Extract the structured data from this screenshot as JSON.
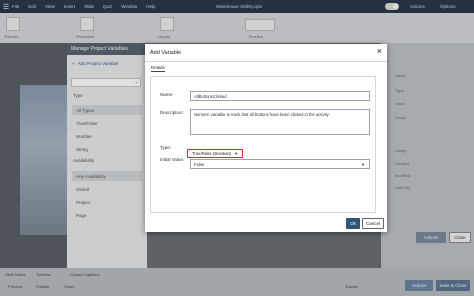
{
  "app": {
    "menu": [
      "File",
      "Edit",
      "View",
      "Insert",
      "Slide",
      "Quiz",
      "Window",
      "Help"
    ],
    "project_title": "Warehouse Safety.cptx",
    "toolbar_groups": [
      "Themes",
      "Properties",
      "Library",
      "Timeline"
    ],
    "right_labels": [
      "Actions",
      "Options"
    ]
  },
  "manage_panel": {
    "title": "Manage Project Variables",
    "add_label": "Add Project Variable",
    "search_placeholder": "",
    "type_section": "Type",
    "type_filters": [
      "All Types",
      "True/False",
      "Number",
      "String"
    ],
    "availability_section": "Availability",
    "availability_filters": [
      "Any Availability",
      "Global",
      "Project",
      "Page"
    ],
    "selected_type": "All Types",
    "selected_availability": "Any Availability"
  },
  "right_panel": {
    "labels": [
      "Name",
      "Type",
      "Value",
      "Scope",
      "Usage",
      "Created",
      "Modified",
      "Used By"
    ],
    "actions_label": "Actions",
    "close_label": "Close"
  },
  "bottom": {
    "tabs": [
      "Slide Notes",
      "Timeline",
      "Closed Captions"
    ],
    "tools": [
      "Preview",
      "Publish",
      "Share"
    ],
    "submit_label": "Submit",
    "save_label": "Save & Close"
  },
  "dialog": {
    "title": "Add Variable",
    "tab_details": "Details",
    "name_label": "Name:",
    "name_value": "AllButtonsClicked",
    "description_label": "Description:",
    "description_value": "Numeric variable to track that all buttons have been clicked in the activity.",
    "type_label": "Type:",
    "type_value": "True/False (Boolean)",
    "initial_label": "Initial Value:",
    "initial_value": "False",
    "ok_label": "Ok",
    "cancel_label": "Cancel"
  }
}
